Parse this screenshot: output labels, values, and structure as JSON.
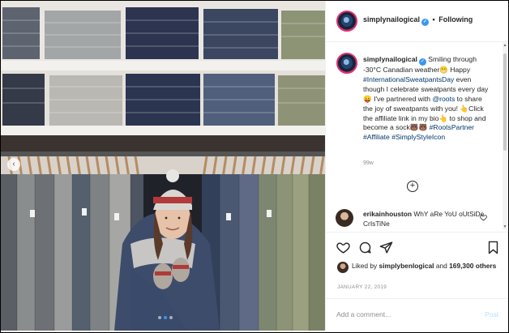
{
  "header": {
    "username": "simplynailogical",
    "separator": "•",
    "follow_status": "Following"
  },
  "caption": {
    "username": "simplynailogical",
    "text_1": "Smiling through -30°C Canadian weather😬 Happy",
    "tag_1": "#InternationalSweatpantsDay",
    "text_2": "even though I celebrate sweatpants every day😛 I've partnered with",
    "mention": "@roots",
    "text_3": "to share the joy of sweatpants with you! 👆Click the affiliate link in my bio👆 to shop and become a sock🐻🐻",
    "tag_2": "#RootsPartner",
    "tag_3": "#Affiliate",
    "tag_4": "#SimplyStyleIcon",
    "time": "99w"
  },
  "load_more": {
    "icon": "plus-circle-icon"
  },
  "comment": {
    "username": "erikainhouston",
    "text": "WhY aRe YoU oUtSiDe CrIsTiNe"
  },
  "likes": {
    "prefix": "Liked by",
    "user": "simplybenlogical",
    "connector": "and",
    "count": "169,300 others"
  },
  "date": "JANUARY 22, 2019",
  "add_comment": {
    "placeholder": "Add a comment...",
    "post_label": "Post"
  },
  "carousel": {
    "prev_glyph": "‹",
    "active_index": 1,
    "count": 3
  },
  "colors": {
    "link": "#00376b",
    "accent": "#3897f0",
    "muted": "#8e8e8e",
    "post_disabled": "#b2dffc"
  }
}
